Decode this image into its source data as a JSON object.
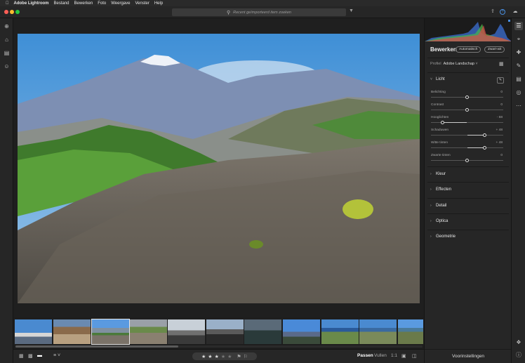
{
  "menubar": {
    "apple": "",
    "app": "Adobe Lightroom",
    "items": [
      "Bestand",
      "Bewerken",
      "Foto",
      "Weergave",
      "Venster",
      "Help"
    ]
  },
  "search": {
    "placeholder": "Recent geïmporteerd item zoeken"
  },
  "edit_panel": {
    "title": "Bewerken",
    "auto_label": "Automatisch",
    "bw_label": "Zwart-wit",
    "profile_label": "Profiel",
    "profile_value": "Adobe Landschap",
    "light": {
      "title": "Licht",
      "sliders": [
        {
          "label": "Belichting",
          "value": "0",
          "pos": 0.5
        },
        {
          "label": "Contrast",
          "value": "0",
          "pos": 0.5
        },
        {
          "label": "Hooglichten",
          "value": "- 68",
          "pos": 0.16
        },
        {
          "label": "Schaduwen",
          "value": "+ 48",
          "pos": 0.74
        },
        {
          "label": "Witte tinten",
          "value": "+ 48",
          "pos": 0.74
        },
        {
          "label": "Zwarte tinten",
          "value": "0",
          "pos": 0.5
        }
      ]
    },
    "sections": [
      "Kleur",
      "Effecten",
      "Detail",
      "Optica",
      "Geometrie"
    ]
  },
  "presets_label": "Voorinstellingen",
  "bottombar": {
    "rating": 3,
    "max_rating": 5,
    "fit": "Passen",
    "fill": "Vullen",
    "ratio": "1:1"
  }
}
